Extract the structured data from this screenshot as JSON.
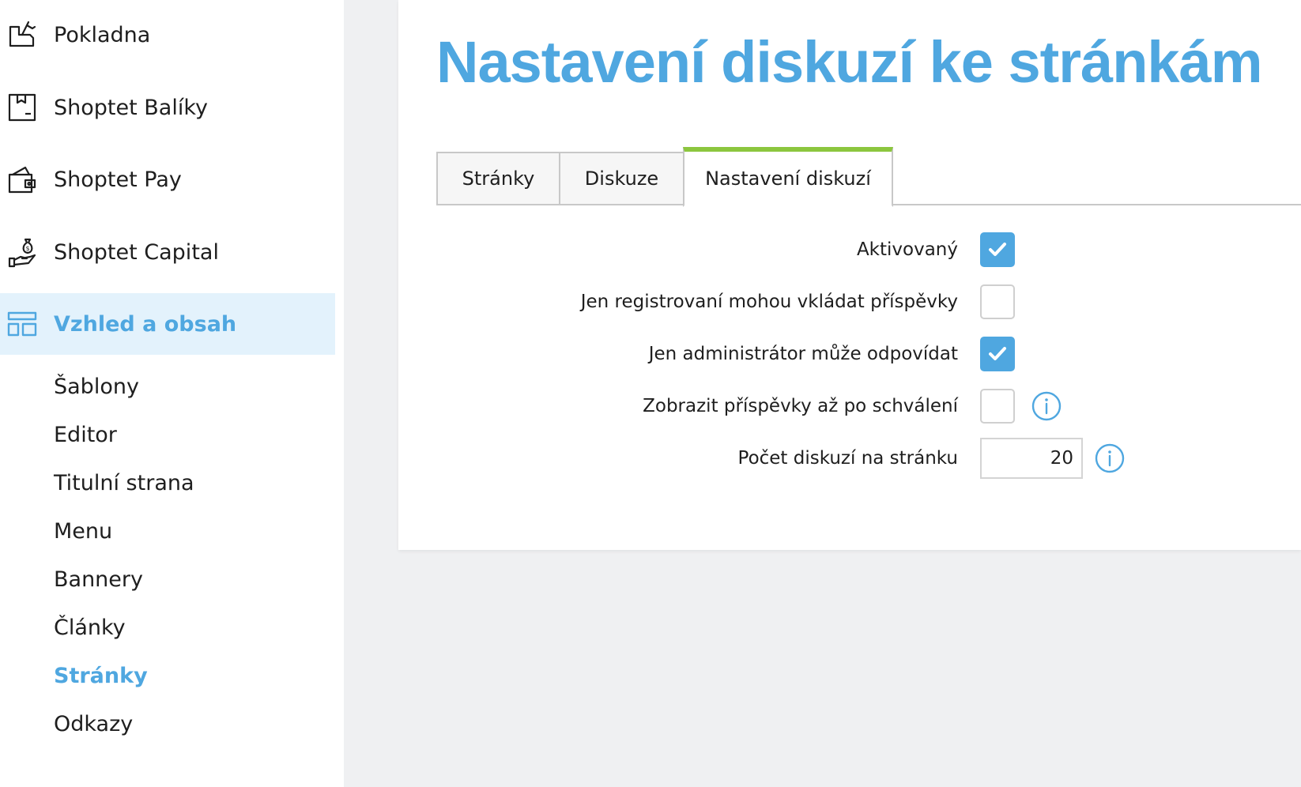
{
  "sidebar": {
    "items": [
      {
        "label": "Pokladna",
        "icon": "cash-register-icon"
      },
      {
        "label": "Shoptet Balíky",
        "icon": "package-icon"
      },
      {
        "label": "Shoptet Pay",
        "icon": "wallet-icon"
      },
      {
        "label": "Shoptet Capital",
        "icon": "money-bag-hand-icon"
      },
      {
        "label": "Vzhled a obsah",
        "icon": "layout-icon",
        "active": true
      }
    ],
    "subitems": [
      {
        "label": "Šablony"
      },
      {
        "label": "Editor"
      },
      {
        "label": "Titulní strana"
      },
      {
        "label": "Menu"
      },
      {
        "label": "Bannery"
      },
      {
        "label": "Články"
      },
      {
        "label": "Stránky",
        "active": true
      },
      {
        "label": "Odkazy"
      }
    ]
  },
  "main": {
    "title": "Nastavení diskuzí ke stránkám",
    "tabs": [
      {
        "label": "Stránky"
      },
      {
        "label": "Diskuze"
      },
      {
        "label": "Nastavení diskuzí",
        "active": true
      }
    ],
    "settings": [
      {
        "label": "Aktivovaný",
        "checked": true
      },
      {
        "label": "Jen registrovaní mohou vkládat příspěvky",
        "checked": false
      },
      {
        "label": "Jen administrátor může odpovídat",
        "checked": true
      },
      {
        "label": "Zobrazit příspěvky až po schválení",
        "checked": false,
        "info": true
      },
      {
        "label": "Počet diskuzí na stránku",
        "value": "20",
        "info": true
      }
    ]
  },
  "colors": {
    "accent": "#4fa7e0",
    "active_tab_border": "#8cc63e",
    "active_nav_bg": "#e3f2fc",
    "page_bg": "#eff0f2"
  }
}
